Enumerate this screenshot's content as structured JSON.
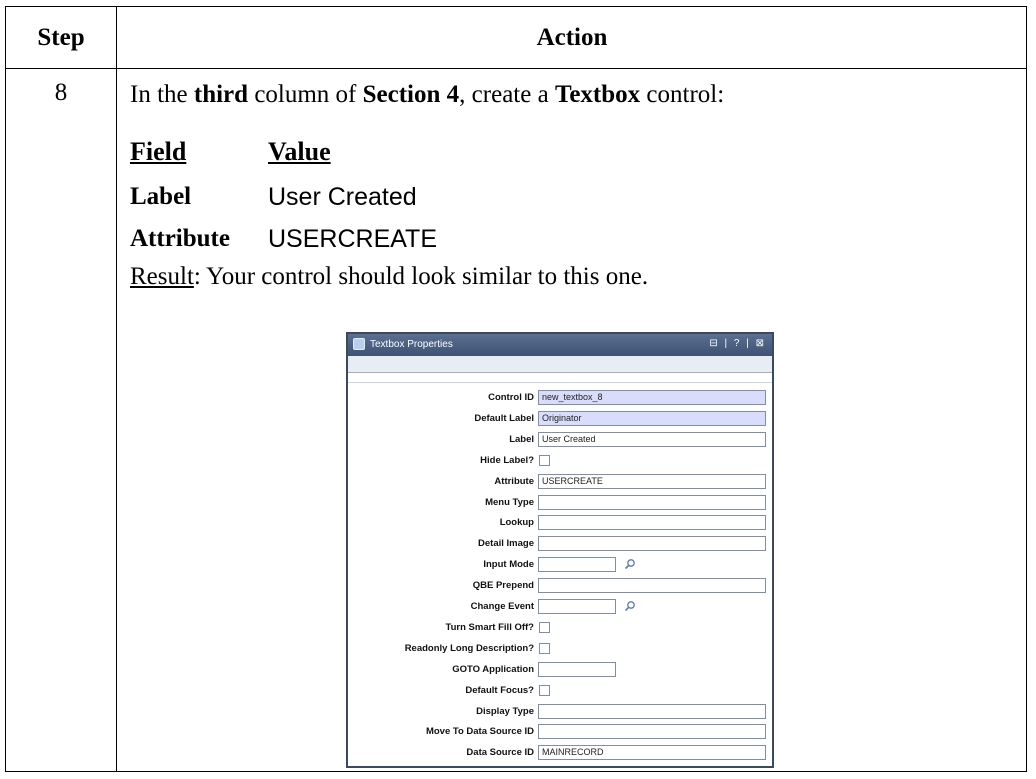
{
  "table": {
    "header_step": "Step",
    "header_action": "Action",
    "step_number": "8"
  },
  "instruction": {
    "p1": "In the ",
    "b1": "third",
    "p2": " column of ",
    "b2": "Section 4",
    "p3": ", create a ",
    "b3": "Textbox",
    "p4": " control:"
  },
  "fields": {
    "header_field": "Field",
    "header_value": "Value",
    "rows": [
      {
        "name": "Label",
        "value": "User Created"
      },
      {
        "name": "Attribute",
        "value": "USERCREATE"
      }
    ]
  },
  "result": {
    "label": "Result",
    "text": ": Your control should look similar to this one."
  },
  "dialog": {
    "title": "Textbox Properties",
    "title_buttons": "⊟ | ? | ⊠",
    "properties": [
      {
        "label": "Control ID",
        "value": "new_textbox_8",
        "kind": "input",
        "readonly": true
      },
      {
        "label": "Default Label",
        "value": "Originator",
        "kind": "input",
        "readonly": true
      },
      {
        "label": "Label",
        "value": "User Created",
        "kind": "input"
      },
      {
        "label": "Hide Label?",
        "value": "",
        "kind": "checkbox"
      },
      {
        "label": "Attribute",
        "value": "USERCREATE",
        "kind": "input"
      },
      {
        "label": "Menu Type",
        "value": "",
        "kind": "input"
      },
      {
        "label": "Lookup",
        "value": "",
        "kind": "input"
      },
      {
        "label": "Detail Image",
        "value": "",
        "kind": "input"
      },
      {
        "label": "Input Mode",
        "value": "",
        "kind": "lookup"
      },
      {
        "label": "QBE Prepend",
        "value": "",
        "kind": "input"
      },
      {
        "label": "Change Event",
        "value": "",
        "kind": "lookup"
      },
      {
        "label": "Turn Smart Fill Off?",
        "value": "",
        "kind": "checkbox"
      },
      {
        "label": "Readonly Long Description?",
        "value": "",
        "kind": "checkbox"
      },
      {
        "label": "GOTO Application",
        "value": "",
        "kind": "short"
      },
      {
        "label": "Default Focus?",
        "value": "",
        "kind": "checkbox"
      },
      {
        "label": "Display Type",
        "value": "",
        "kind": "input"
      },
      {
        "label": "Move To Data Source ID",
        "value": "",
        "kind": "input"
      },
      {
        "label": "Data Source ID",
        "value": "MAINRECORD",
        "kind": "input"
      }
    ]
  }
}
